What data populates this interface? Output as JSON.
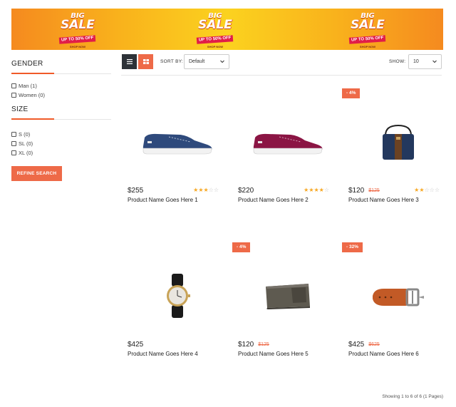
{
  "banner": {
    "badges": [
      {
        "big": "BIG",
        "sale": "SALE",
        "upto": "UP TO 50% OFF",
        "shop": "SHOP NOW"
      },
      {
        "big": "BIG",
        "sale": "SALE",
        "upto": "UP TO 50% OFF",
        "shop": "SHOP NOW"
      },
      {
        "big": "BIG",
        "sale": "SALE",
        "upto": "UP TO 50% OFF",
        "shop": "SHOP NOW"
      }
    ],
    "colors": {
      "orange": "#f58a1f",
      "yellow": "#fbd21f"
    }
  },
  "sidebar": {
    "gender_title": "GENDER",
    "gender_options": [
      {
        "label": "Man (1)"
      },
      {
        "label": "Women (0)"
      }
    ],
    "size_title": "SIZE",
    "size_options": [
      {
        "label": "S (0)"
      },
      {
        "label": "SL (0)"
      },
      {
        "label": "XL (0)"
      }
    ],
    "refine_label": "REFINE SEARCH"
  },
  "toolbar": {
    "sort_label": "SORT BY:",
    "sort_value": "Default",
    "show_label": "SHOW:",
    "show_value": "10"
  },
  "products": [
    {
      "price": "$255",
      "old_price": "",
      "discount": "",
      "rating": 3,
      "name": "Product Name Goes Here 1",
      "icon": "blue-sneaker-icon"
    },
    {
      "price": "$220",
      "old_price": "",
      "discount": "",
      "rating": 4,
      "name": "Product Name Goes Here 2",
      "icon": "maroon-sneaker-icon"
    },
    {
      "price": "$120",
      "old_price": "$125",
      "discount": "- 4%",
      "rating": 2,
      "name": "Product Name Goes Here 3",
      "icon": "shoulder-bag-icon"
    },
    {
      "price": "$425",
      "old_price": "",
      "discount": "",
      "rating": 0,
      "name": "Product Name Goes Here 4",
      "icon": "wristwatch-icon"
    },
    {
      "price": "$120",
      "old_price": "$125",
      "discount": "- 4%",
      "rating": 0,
      "name": "Product Name Goes Here 5",
      "icon": "wallet-icon"
    },
    {
      "price": "$425",
      "old_price": "$625",
      "discount": "- 32%",
      "rating": 0,
      "name": "Product Name Goes Here 6",
      "icon": "belt-icon"
    }
  ],
  "footer": {
    "showing": "Showing 1 to 6 of 6 (1 Pages)"
  },
  "colors": {
    "accent": "#ee6a48",
    "dark": "#2d3238",
    "star": "#f7a823"
  }
}
